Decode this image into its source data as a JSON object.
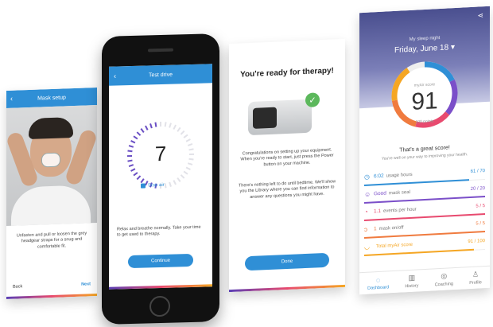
{
  "screen1": {
    "title": "Mask setup",
    "instruction": "Unfasten and pull or loosen the grey headgear straps for a snug and comfortable fit.",
    "back_label": "Back",
    "next_label": "Next"
  },
  "screen2": {
    "title": "Test drive",
    "countdown": "7",
    "stop_label": "Stop air",
    "instruction": "Relax and breathe normally. Take your time to get used to therapy.",
    "continue_label": "Continue"
  },
  "screen3": {
    "title": "You're ready for therapy!",
    "para1": "Congratulations on setting up your equipment. When you're ready to start, just press the Power button on your machine.",
    "para2": "There's nothing left to do until bedtime. We'll show you the Library where you can find information to answer any questions you might have.",
    "done_label": "Done"
  },
  "screen4": {
    "night_label": "My sleep night",
    "date": "Friday, June 18",
    "score_label": "myAir score",
    "score": "91",
    "score_max_label": "100 points",
    "score_fraction": 0.91,
    "message": "That's a great score!",
    "submessage": "You're well on your way to improving your health.",
    "metrics": [
      {
        "icon": "clock-icon",
        "value": "6:02",
        "label": "usage hours",
        "score": "61 / 70",
        "fraction": 0.87,
        "color": "#2f8fd6"
      },
      {
        "icon": "mask-icon",
        "value": "Good",
        "label": "mask seal",
        "score": "20 / 20",
        "fraction": 1.0,
        "color": "#7b4fc9"
      },
      {
        "icon": "events-icon",
        "value": "1.1",
        "label": "events per hour",
        "score": "5 / 5",
        "fraction": 1.0,
        "color": "#e84a6f"
      },
      {
        "icon": "plug-icon",
        "value": "1",
        "label": "mask on/off",
        "score": "5 / 5",
        "fraction": 1.0,
        "color": "#f07b3f"
      },
      {
        "icon": "score-icon",
        "value": "",
        "label": "Total myAir score",
        "score": "91 / 100",
        "fraction": 0.91,
        "color": "#f5a623"
      }
    ],
    "tabs": [
      {
        "label": "Dashboard",
        "icon": "dashboard-icon"
      },
      {
        "label": "History",
        "icon": "history-icon"
      },
      {
        "label": "Coaching",
        "icon": "coaching-icon"
      },
      {
        "label": "Profile",
        "icon": "profile-icon"
      }
    ]
  },
  "colors": {
    "accent": "#2f8fd6"
  }
}
